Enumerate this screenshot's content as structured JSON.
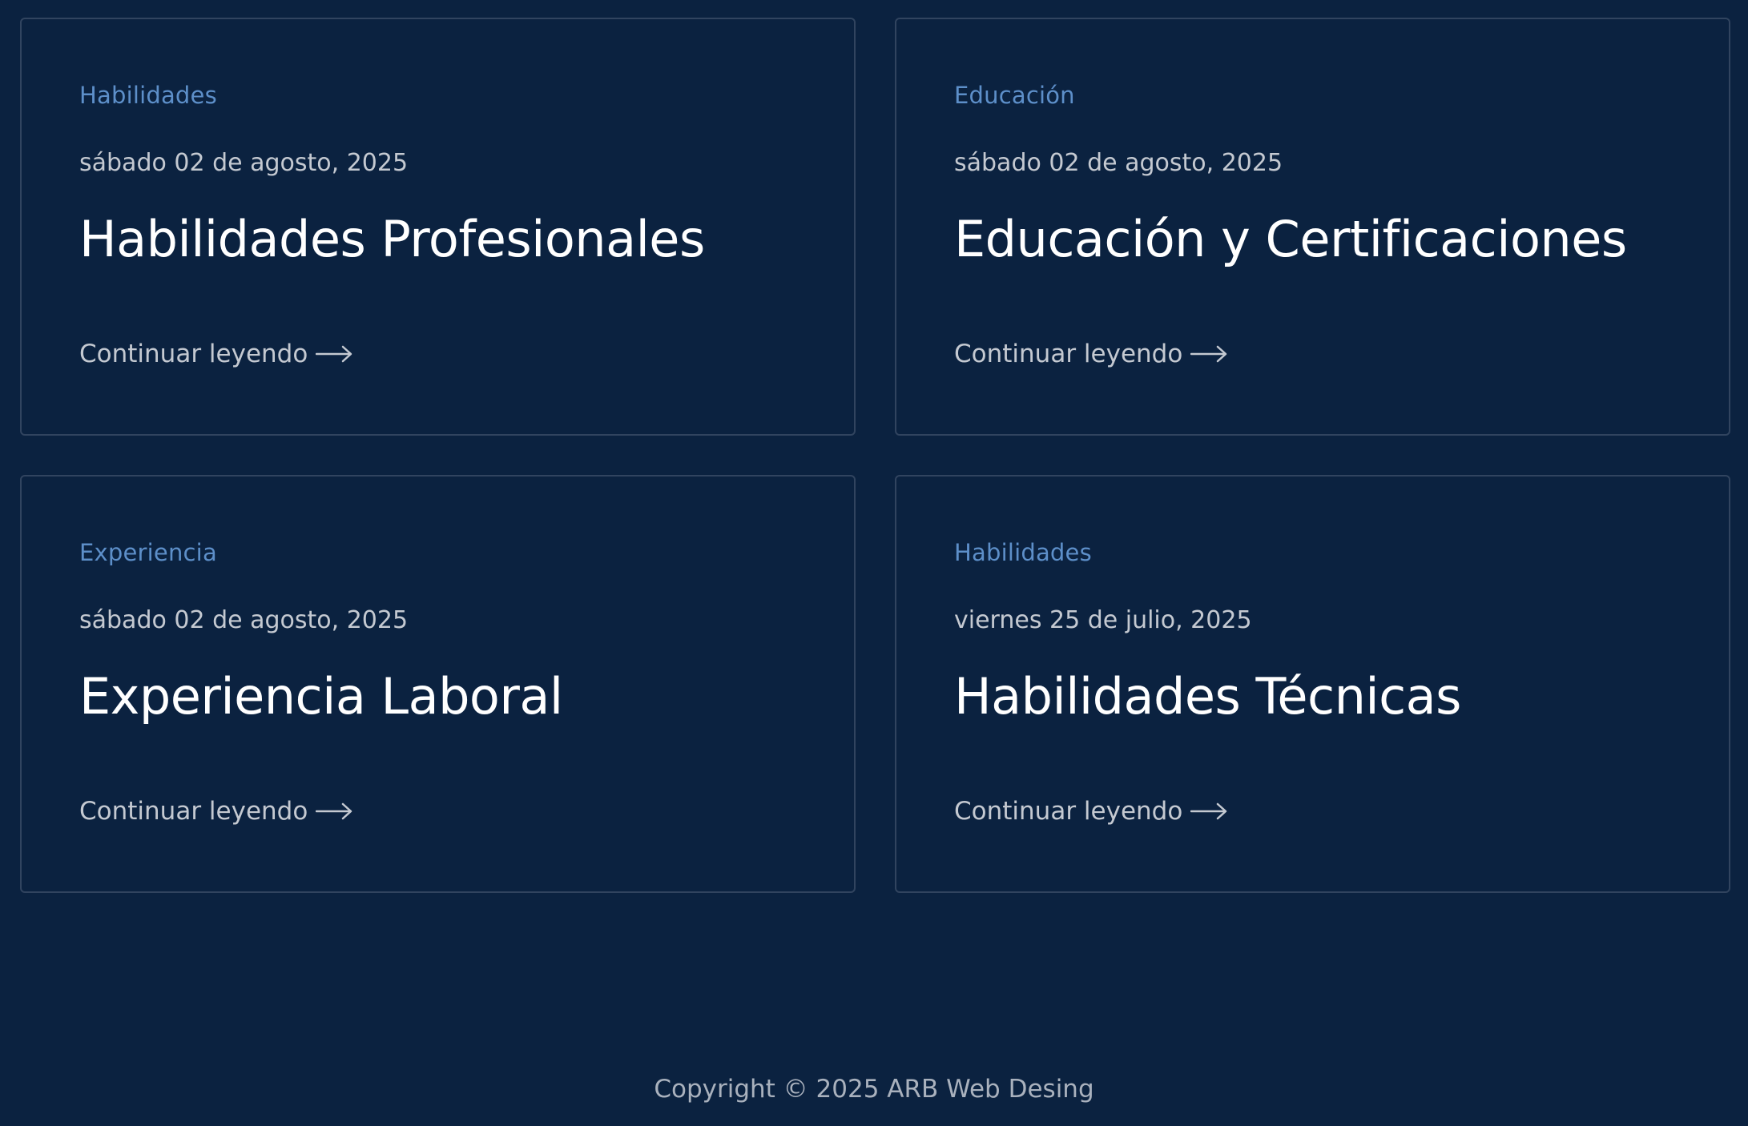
{
  "cards": [
    {
      "category": "Habilidades",
      "date": "sábado 02 de agosto, 2025",
      "title": "Habilidades Profesionales",
      "link_label": "Continuar leyendo"
    },
    {
      "category": "Educación",
      "date": "sábado 02 de agosto, 2025",
      "title": "Educación y Certificaciones",
      "link_label": "Continuar leyendo"
    },
    {
      "category": "Experiencia",
      "date": "sábado 02 de agosto, 2025",
      "title": "Experiencia Laboral",
      "link_label": "Continuar leyendo"
    },
    {
      "category": "Habilidades",
      "date": "viernes 25 de julio, 2025",
      "title": "Habilidades Técnicas",
      "link_label": "Continuar leyendo"
    }
  ],
  "footer": {
    "copyright": "Copyright © 2025 ARB Web Desing"
  },
  "colors": {
    "background": "#0b2240",
    "card_border": "#31445f",
    "category_accent": "#5d8fc9",
    "title_text": "#ffffff",
    "muted_text": "#c4c9d1"
  },
  "icons": {
    "read_more": "arrow-right-icon"
  }
}
